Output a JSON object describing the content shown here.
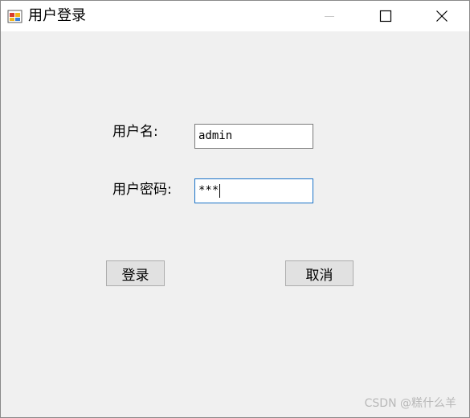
{
  "window": {
    "title": "用户登录",
    "icon": "winforms-app-icon",
    "controls": {
      "minimize_icon": "minimize-icon",
      "maximize_icon": "maximize-icon",
      "close_icon": "close-icon"
    }
  },
  "form": {
    "username_label": "用户名:",
    "username_value": "admin",
    "password_label": "用户密码:",
    "password_value": "***",
    "login_button": "登录",
    "cancel_button": "取消"
  },
  "watermark": "CSDN @糕什么羊",
  "colors": {
    "client_bg": "#f0f0f0",
    "titlebar_bg": "#ffffff",
    "focus_border": "#1a73c8",
    "button_bg": "#e1e1e1"
  }
}
